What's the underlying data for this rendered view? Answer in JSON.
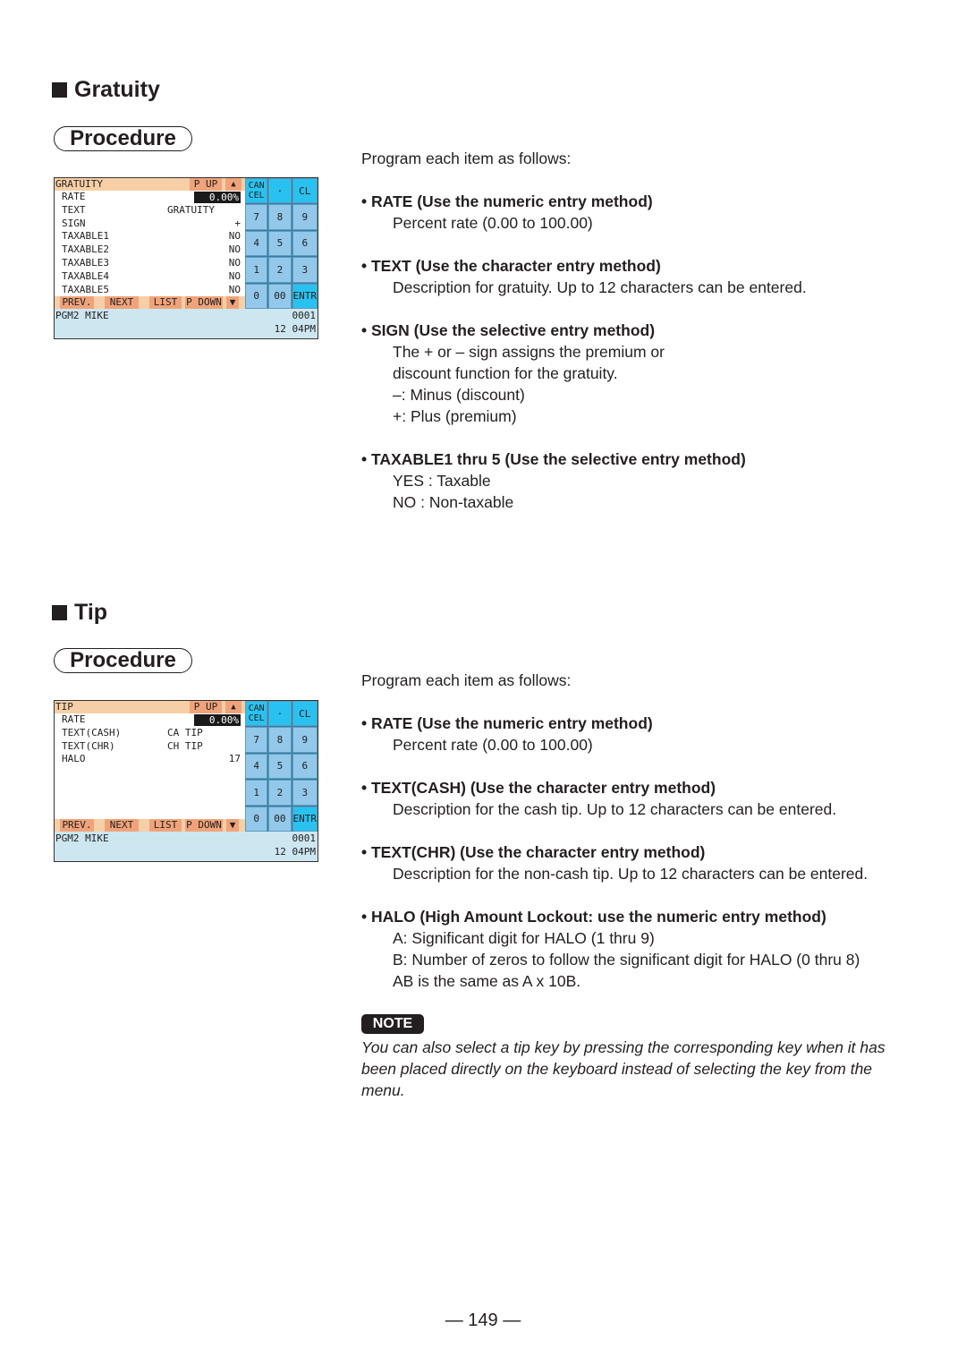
{
  "gratuity": {
    "section_title": "Gratuity",
    "procedure_label": "Procedure",
    "screen": {
      "title": "GRATUITY",
      "page_up": "P UP",
      "up_arrow": "▲",
      "rows": [
        {
          "label": "RATE",
          "mid": "",
          "value": "0.00%"
        },
        {
          "label": "TEXT",
          "mid": "GRATUITY",
          "value": ""
        },
        {
          "label": "SIGN",
          "mid": "",
          "value": "+"
        },
        {
          "label": "TAXABLE1",
          "mid": "",
          "value": "NO"
        },
        {
          "label": "TAXABLE2",
          "mid": "",
          "value": "NO"
        },
        {
          "label": "TAXABLE3",
          "mid": "",
          "value": "NO"
        },
        {
          "label": "TAXABLE4",
          "mid": "",
          "value": "NO"
        },
        {
          "label": "TAXABLE5",
          "mid": "",
          "value": "NO"
        }
      ],
      "footer": [
        "PREV.",
        "NEXT",
        "LIST",
        "P DOWN",
        "▼"
      ],
      "status": {
        "operator": "PGM2   MIKE",
        "number": "0001",
        "time": "12 04PM"
      }
    },
    "intro": "Program each item as follows:",
    "items": [
      {
        "heading": "• RATE (Use the numeric entry method)",
        "lines": [
          "Percent rate (0.00 to 100.00)"
        ]
      },
      {
        "heading": "• TEXT (Use the character entry method)",
        "lines": [
          "Description for gratuity. Up to 12 characters can be entered."
        ]
      },
      {
        "heading": "• SIGN (Use the selective entry method)",
        "lines": [
          "The + or – sign assigns the premium or",
          "discount function for the gratuity.",
          "–: Minus (discount)",
          "+: Plus (premium)"
        ]
      },
      {
        "heading": "• TAXABLE1 thru 5 (Use the selective entry method)",
        "lines": [
          "YES  :  Taxable",
          "NO    :  Non-taxable"
        ]
      }
    ]
  },
  "tip": {
    "section_title": "Tip",
    "procedure_label": "Procedure",
    "screen": {
      "title": "TIP",
      "page_up": "P UP",
      "up_arrow": "▲",
      "rows": [
        {
          "label": "RATE",
          "mid": "",
          "value": "0.00%"
        },
        {
          "label": "TEXT(CASH)",
          "mid": "CA TIP",
          "value": ""
        },
        {
          "label": "TEXT(CHR)",
          "mid": "CH TIP",
          "value": ""
        },
        {
          "label": "HALO",
          "mid": "",
          "value": "17"
        }
      ],
      "footer": [
        "PREV.",
        "NEXT",
        "LIST",
        "P DOWN",
        "▼"
      ],
      "status": {
        "operator": "PGM2   MIKE",
        "number": "0001",
        "time": "12 04PM"
      }
    },
    "intro": "Program each item as follows:",
    "items": [
      {
        "heading": "• RATE (Use the numeric entry method)",
        "lines": [
          "Percent rate (0.00 to 100.00)"
        ]
      },
      {
        "heading": "• TEXT(CASH) (Use the character entry method)",
        "lines": [
          "Description for the cash tip. Up to 12 characters can be entered."
        ]
      },
      {
        "heading": "• TEXT(CHR) (Use the character entry method)",
        "lines": [
          "Description for the non-cash tip. Up to 12 characters can be entered."
        ]
      },
      {
        "heading": "• HALO (High Amount Lockout: use the numeric entry method)",
        "lines": [
          "A: Significant digit for HALO (1 thru 9)",
          "B: Number of zeros to follow the significant digit for HALO (0 thru 8)",
          "AB is the same as A x 10B."
        ]
      }
    ],
    "note_label": "NOTE",
    "note_text": "You can also select a tip key by pressing the corresponding key when it has been placed directly on the keyboard instead of selecting the key from the menu."
  },
  "keypad": {
    "keys": [
      {
        "label": "CAN|CEL",
        "style": "cyan"
      },
      {
        "label": "·",
        "style": "cyan"
      },
      {
        "label": "CL",
        "style": "cyan"
      },
      {
        "label": "7",
        "style": ""
      },
      {
        "label": "8",
        "style": ""
      },
      {
        "label": "9",
        "style": ""
      },
      {
        "label": "4",
        "style": ""
      },
      {
        "label": "5",
        "style": ""
      },
      {
        "label": "6",
        "style": ""
      },
      {
        "label": "1",
        "style": ""
      },
      {
        "label": "2",
        "style": ""
      },
      {
        "label": "3",
        "style": ""
      },
      {
        "label": "0",
        "style": ""
      },
      {
        "label": "00",
        "style": ""
      },
      {
        "label": "ENTR",
        "style": "cyan"
      }
    ]
  },
  "page_number": "— 149 —"
}
